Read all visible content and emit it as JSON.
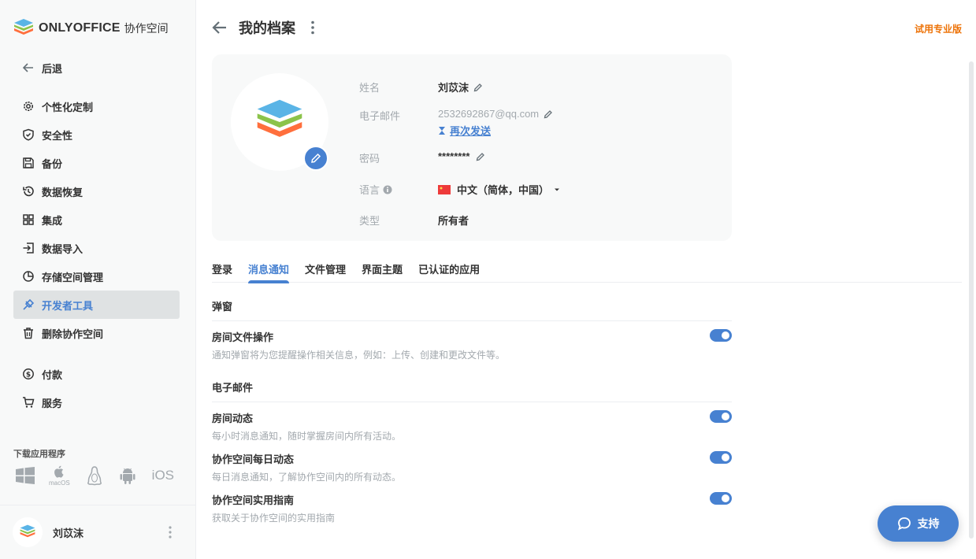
{
  "app": {
    "logo_text": "ONLYOFFICE",
    "logo_sub": "协作空间"
  },
  "sidebar": {
    "back": "后退",
    "items": [
      {
        "label": "个性化定制",
        "icon": "gear-icon"
      },
      {
        "label": "安全性",
        "icon": "shield-icon"
      },
      {
        "label": "备份",
        "icon": "floppy-icon"
      },
      {
        "label": "数据恢复",
        "icon": "history-icon"
      },
      {
        "label": "集成",
        "icon": "grid-icon"
      },
      {
        "label": "数据导入",
        "icon": "import-icon"
      },
      {
        "label": "存储空间管理",
        "icon": "pie-chart-icon"
      },
      {
        "label": "开发者工具",
        "icon": "developer-tools-icon",
        "active": true
      },
      {
        "label": "删除协作空间",
        "icon": "trash-icon"
      }
    ],
    "items2": [
      {
        "label": "付款",
        "icon": "dollar-icon"
      },
      {
        "label": "服务",
        "icon": "cart-icon"
      }
    ],
    "download_label": "下载应用程序",
    "platforms": {
      "macos": "macOS",
      "ios": "iOS"
    }
  },
  "user": {
    "name": "刘苡沫"
  },
  "header": {
    "title": "我的档案",
    "trial": "试用专业版"
  },
  "profile": {
    "name_label": "姓名",
    "name_value": "刘苡沫",
    "email_label": "电子邮件",
    "email_value": "2532692867@qq.com",
    "resend": "再次发送",
    "password_label": "密码",
    "password_value": "********",
    "language_label": "语言",
    "language_value": "中文（简体，中国）",
    "type_label": "类型",
    "type_value": "所有者"
  },
  "tabs": [
    "登录",
    "消息通知",
    "文件管理",
    "界面主题",
    "已认证的应用"
  ],
  "active_tab": "消息通知",
  "sections": {
    "popup": "弹窗",
    "email": "电子邮件"
  },
  "settings": [
    {
      "title": "房间文件操作",
      "desc": "通知弹窗将为您提醒操作相关信息，例如：上传、创建和更改文件等。",
      "on": true
    },
    {
      "title": "房间动态",
      "desc": "每小时消息通知，随时掌握房间内所有活动。",
      "on": true
    },
    {
      "title": "协作空间每日动态",
      "desc": "每日消息通知，了解协作空间内的所有动态。",
      "on": true
    },
    {
      "title": "协作空间实用指南",
      "desc": "获取关于协作空间的实用指南",
      "on": true
    }
  ],
  "support": "支持",
  "colors": {
    "accent": "#4781d1",
    "trial": "#ed7309",
    "logo_blue": "#5ab4e6",
    "logo_green": "#8bc34a",
    "logo_orange": "#ff6f3d"
  }
}
